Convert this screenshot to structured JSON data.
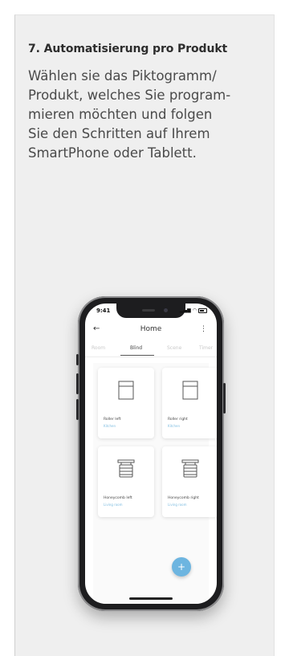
{
  "section": {
    "heading": "7. Automatisierung pro Produkt",
    "body_lines": [
      "Wählen sie das Piktogramm/",
      "Produkt, welches Sie program-",
      "mieren möchten und folgen",
      "Sie den Schritten auf Ihrem",
      "SmartPhone oder Tablett."
    ]
  },
  "phone": {
    "status_time": "9:41",
    "app_title": "Home",
    "back_icon": "back-arrow-icon",
    "menu_icon": "more-vertical-icon",
    "tabs": [
      {
        "label": "Room",
        "active": false
      },
      {
        "label": "Blind",
        "active": true
      },
      {
        "label": "Scene",
        "active": false
      },
      {
        "label": "Timer",
        "active": false
      }
    ],
    "cards": [
      {
        "name": "Roller left",
        "sub": "Kitchen",
        "icon": "roller-blind-icon"
      },
      {
        "name": "Roller right",
        "sub": "Kitchen",
        "icon": "roller-blind-icon"
      },
      {
        "name": "Honeycomb left",
        "sub": "Living room",
        "icon": "honeycomb-blind-icon"
      },
      {
        "name": "Honeycomb right",
        "sub": "Living room",
        "icon": "honeycomb-blind-icon"
      }
    ],
    "fab_label": "+",
    "colors": {
      "accent": "#6db5e0",
      "panel": "#efefef"
    }
  }
}
